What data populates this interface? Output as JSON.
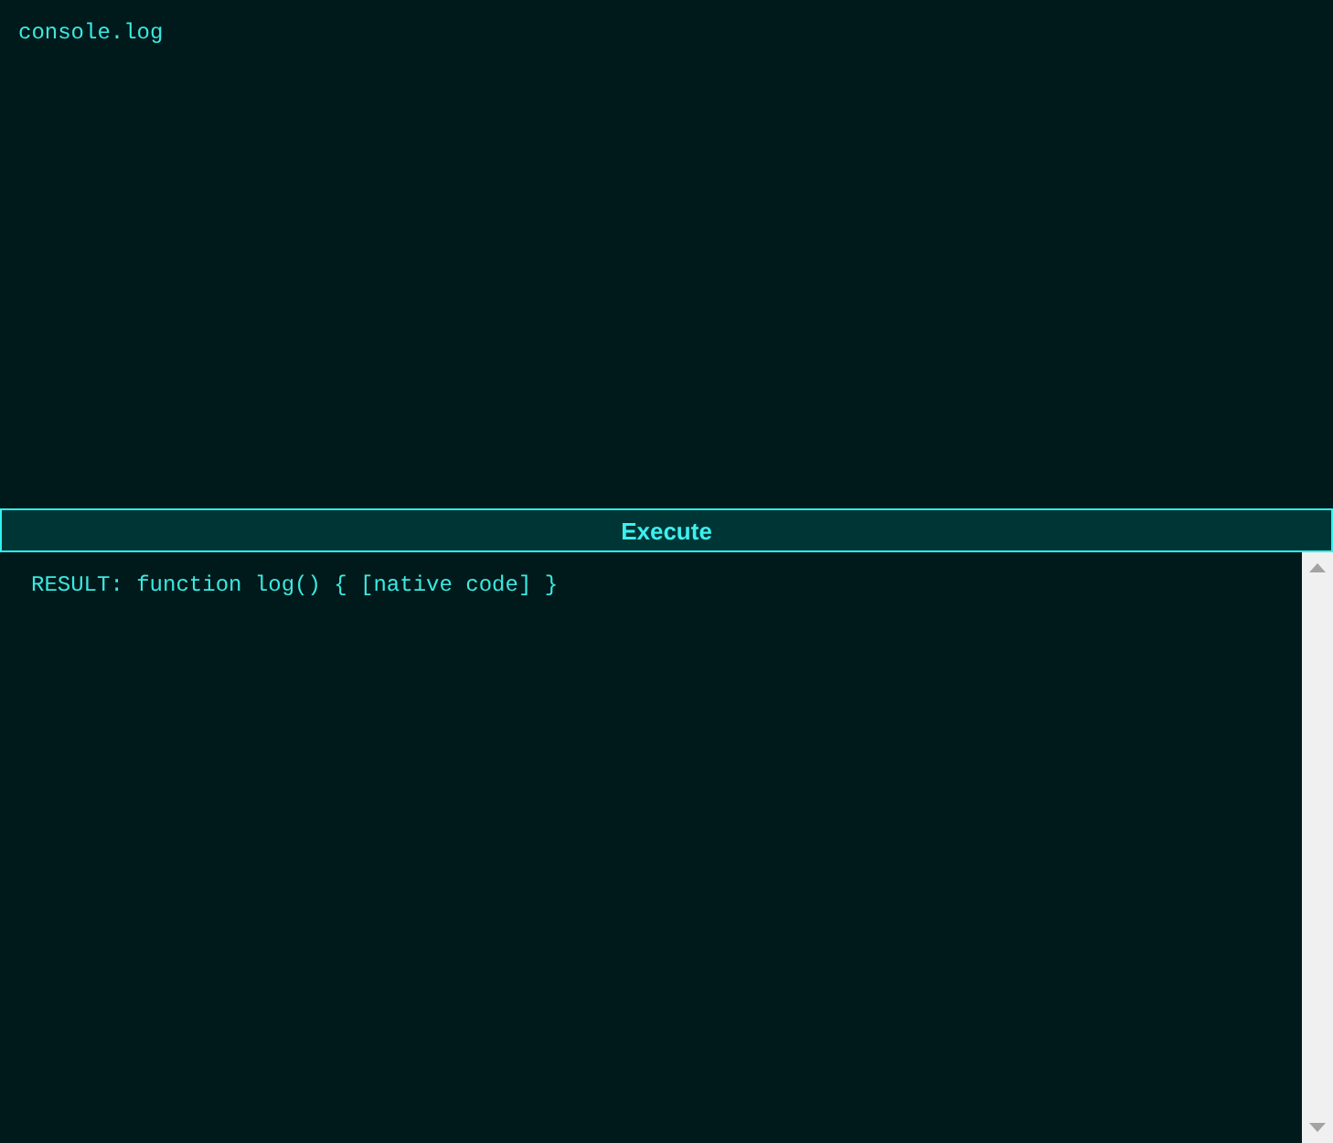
{
  "editor": {
    "value": "console.log"
  },
  "execute_button": {
    "label": "Execute"
  },
  "output": {
    "text": "RESULT: function log() { [native code] }"
  }
}
